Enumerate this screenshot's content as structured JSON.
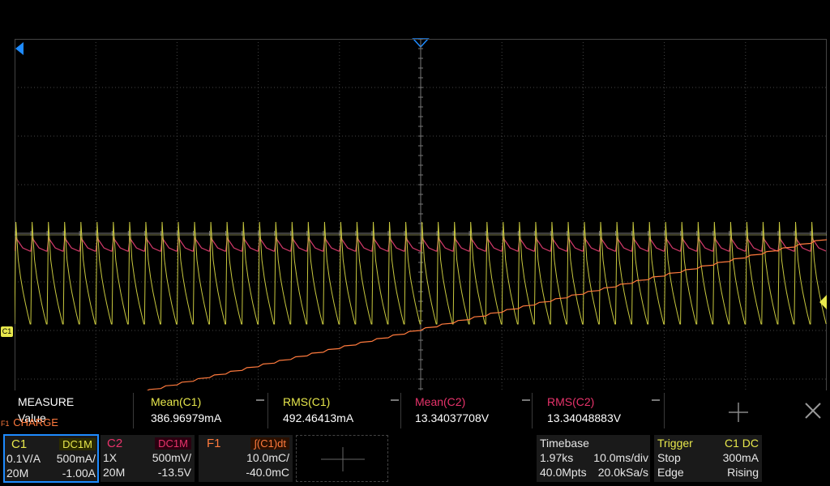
{
  "colors": {
    "background": "#000000",
    "grid": "#555555",
    "c1": "#e8e84c",
    "c2": "#e8336b",
    "f1": "#ff7a3d",
    "trigger_marker": "#1e8bff",
    "accent_blue": "#1e8bff"
  },
  "markers": {
    "c1_label": "C1",
    "f1_label": "F1",
    "f1_name": "CHARGE"
  },
  "measure": {
    "title": "MEASURE",
    "row_label": "Value",
    "items": [
      {
        "name": "Mean(C1)",
        "value": "386.96979mA",
        "color": "#e8e84c"
      },
      {
        "name": "RMS(C1)",
        "value": "492.46413mA",
        "color": "#e8e84c"
      },
      {
        "name": "Mean(C2)",
        "value": "13.34037708V",
        "color": "#e8336b"
      },
      {
        "name": "RMS(C2)",
        "value": "13.34048883V",
        "color": "#e8336b"
      }
    ]
  },
  "channels": {
    "c1": {
      "label": "C1",
      "coupling": "DC1M",
      "probe": "0.1V/A",
      "scale": "500mA/",
      "bw": "20M",
      "offset": "-1.00A"
    },
    "c2": {
      "label": "C2",
      "coupling": "DC1M",
      "probe": "1X",
      "scale": "500mV/",
      "bw": "20M",
      "offset": "-13.5V"
    },
    "f1": {
      "label": "F1",
      "expr": "∫(C1)dt",
      "scale": "10.0mC/",
      "offset": "-40.0mC"
    }
  },
  "timebase": {
    "title": "Timebase",
    "delay": "1.97ks",
    "scale": "10.0ms/div",
    "memory": "40.0Mpts",
    "sample_rate": "20.0kSa/s"
  },
  "trigger": {
    "title": "Trigger",
    "source": "C1 DC",
    "mode": "Stop",
    "level": "300mA",
    "type": "Edge",
    "slope": "Rising"
  }
}
